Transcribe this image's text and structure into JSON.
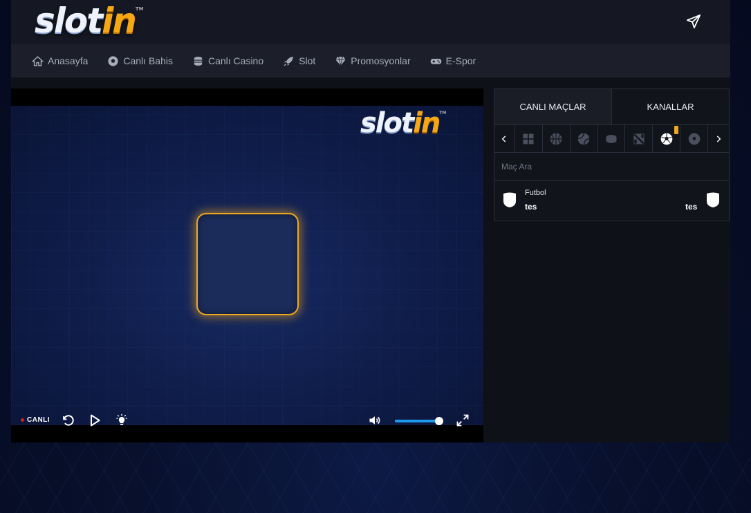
{
  "brand": {
    "logo_main": "slot",
    "logo_accent": "in",
    "logo_tm": "TM",
    "accent_color": "#f6a814"
  },
  "header": {
    "send_icon": "paper-plane-icon"
  },
  "nav": {
    "items": [
      {
        "label": "Anasayfa",
        "icon": "home-icon"
      },
      {
        "label": "Canlı Bahis",
        "icon": "soccer-ball-icon"
      },
      {
        "label": "Canlı Casino",
        "icon": "coins-icon"
      },
      {
        "label": "Slot",
        "icon": "rocket-icon"
      },
      {
        "label": "Promosyonlar",
        "icon": "diamond-icon"
      },
      {
        "label": "E-Spor",
        "icon": "gamepad-icon"
      }
    ]
  },
  "player": {
    "live_label": "CANLI",
    "live_color": "#e01d1d",
    "volume_level": 1.0,
    "volume_color": "#1e9bf0",
    "loader_border_color": "#f0a81f"
  },
  "panel": {
    "tabs": [
      {
        "label": "CANLI MAÇLAR",
        "active": true
      },
      {
        "label": "KANALLAR",
        "active": false
      }
    ],
    "sport_filters": [
      "all-sports-grid-icon",
      "basketball-icon",
      "tennis-icon",
      "ice-hockey-icon",
      "dota-icon",
      "soccer-ball-icon",
      "futsal-icon"
    ],
    "active_sport": "soccer-ball-icon",
    "search": {
      "placeholder": "Maç Ara",
      "value": ""
    },
    "matches": [
      {
        "sport": "Futbol",
        "home": "tes",
        "away": "tes"
      }
    ]
  }
}
